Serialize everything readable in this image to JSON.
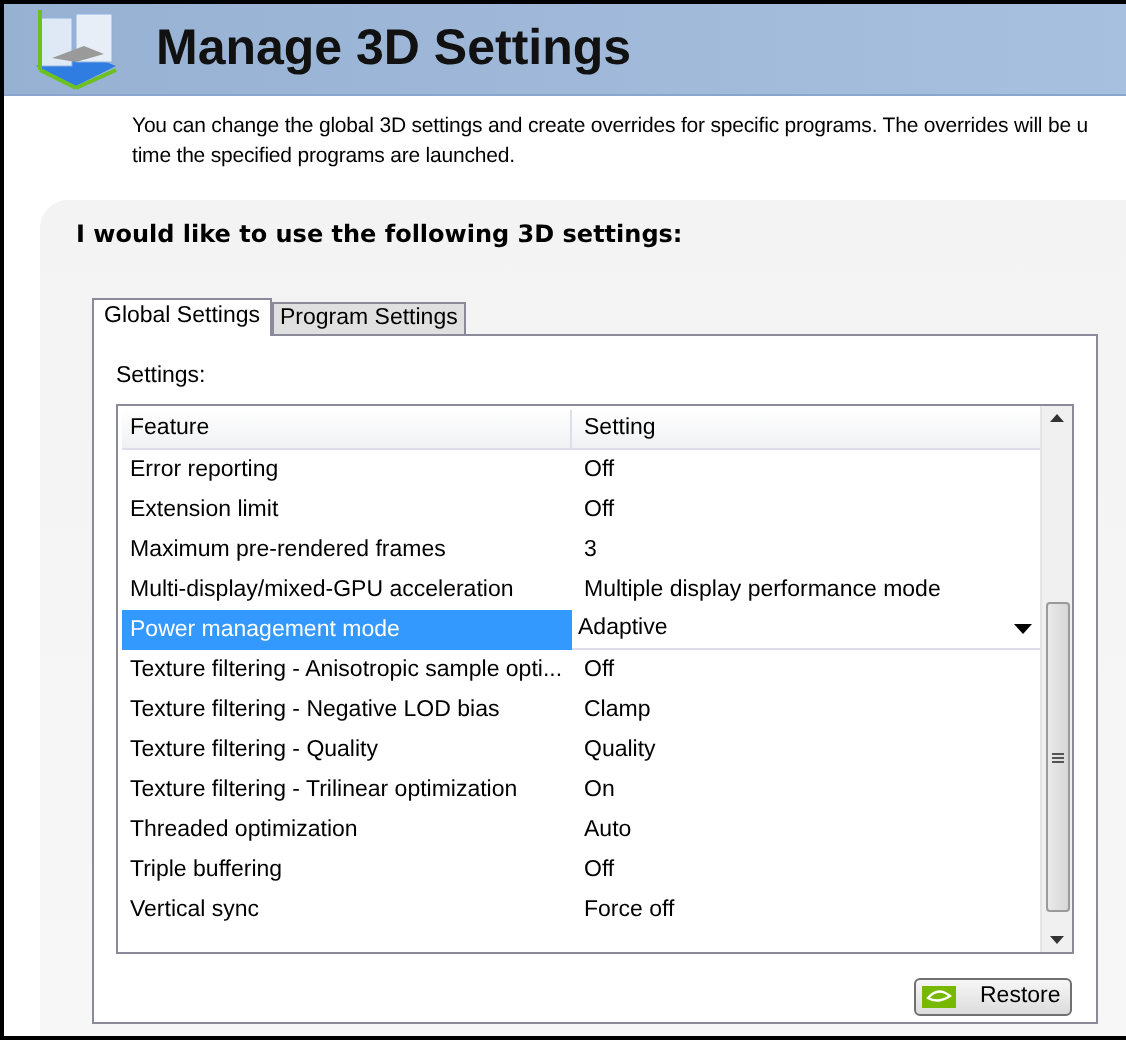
{
  "header": {
    "title": "Manage 3D Settings"
  },
  "description": [
    "You can change the global 3D settings and create overrides for specific programs. The overrides will be u",
    "time the specified programs are launched."
  ],
  "panel": {
    "heading": "I would like to use the following 3D settings:",
    "tabs": [
      {
        "label": "Global Settings",
        "selected": true
      },
      {
        "label": "Program Settings",
        "selected": false
      }
    ],
    "settings_label": "Settings:",
    "table": {
      "columns": [
        "Feature",
        "Setting"
      ],
      "rows": [
        {
          "feature": "Error reporting",
          "setting": "Off",
          "selected": false
        },
        {
          "feature": "Extension limit",
          "setting": "Off",
          "selected": false
        },
        {
          "feature": "Maximum pre-rendered frames",
          "setting": "3",
          "selected": false
        },
        {
          "feature": "Multi-display/mixed-GPU acceleration",
          "setting": "Multiple display performance mode",
          "selected": false
        },
        {
          "feature": "Power management mode",
          "setting": "Adaptive",
          "selected": true
        },
        {
          "feature": "Texture filtering - Anisotropic sample opti...",
          "setting": "Off",
          "selected": false
        },
        {
          "feature": "Texture filtering - Negative LOD bias",
          "setting": "Clamp",
          "selected": false
        },
        {
          "feature": "Texture filtering - Quality",
          "setting": "Quality",
          "selected": false
        },
        {
          "feature": "Texture filtering - Trilinear optimization",
          "setting": "On",
          "selected": false
        },
        {
          "feature": "Threaded optimization",
          "setting": "Auto",
          "selected": false
        },
        {
          "feature": "Triple buffering",
          "setting": "Off",
          "selected": false
        },
        {
          "feature": "Vertical sync",
          "setting": "Force off",
          "selected": false
        }
      ]
    },
    "restore_button": "Restore"
  }
}
